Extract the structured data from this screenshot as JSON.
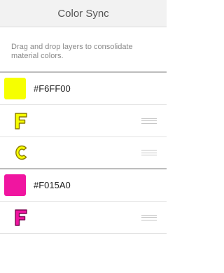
{
  "header": {
    "title": "Color Sync"
  },
  "description": "Drag and drop layers to consolidate material colors.",
  "groups": [
    {
      "hex": "#F6FF00",
      "color": "#F6FF00",
      "layers": [
        {
          "glyph": "F",
          "icon": "letter-f-icon"
        },
        {
          "glyph": "C",
          "icon": "letter-c-icon"
        }
      ]
    },
    {
      "hex": "#F015A0",
      "color": "#F015A0",
      "layers": [
        {
          "glyph": "F",
          "icon": "letter-f-icon"
        }
      ]
    }
  ]
}
